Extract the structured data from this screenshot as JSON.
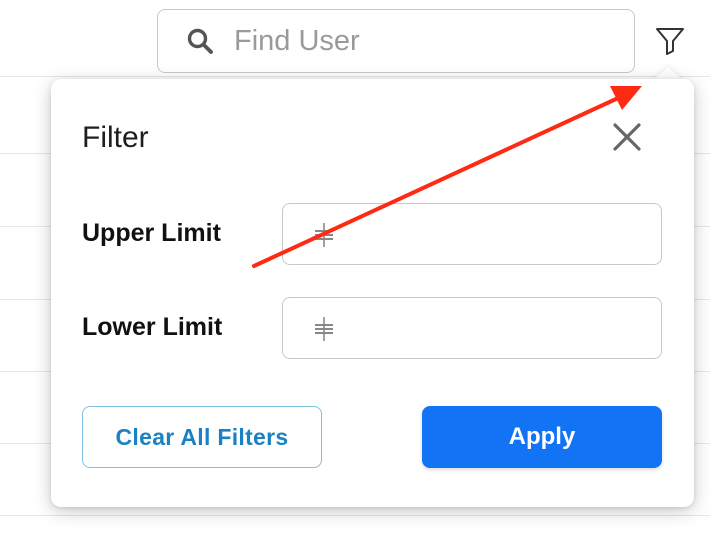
{
  "search": {
    "placeholder": "Find User",
    "icon": "search-icon"
  },
  "filter_toggle": {
    "icon": "filter-funnel-icon"
  },
  "filter_popover": {
    "title": "Filter",
    "close_icon": "close-icon",
    "fields": [
      {
        "label": "Upper Limit",
        "value": "",
        "icon": "number-stepper-icon"
      },
      {
        "label": "Lower Limit",
        "value": "",
        "icon": "number-stepper-icon"
      }
    ],
    "clear_label": "Clear All Filters",
    "apply_label": "Apply"
  },
  "annotation": {
    "type": "arrow",
    "color": "#ff2a14"
  },
  "colors": {
    "accent": "#1273f5",
    "clear_text": "#1a82c4",
    "clear_border": "#7fbfe0"
  }
}
